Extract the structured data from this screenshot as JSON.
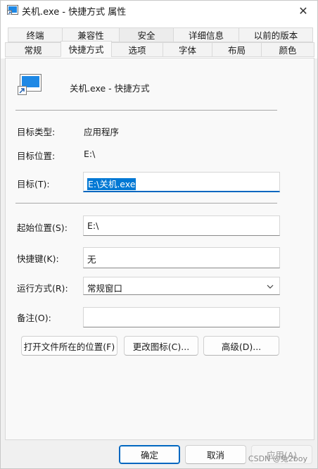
{
  "window": {
    "title": "关机.exe - 快捷方式 属性",
    "close_glyph": "✕"
  },
  "tabs": {
    "row1": [
      "终端",
      "兼容性",
      "安全",
      "详细信息",
      "以前的版本"
    ],
    "row2": [
      "常规",
      "快捷方式",
      "选项",
      "字体",
      "布局",
      "颜色"
    ],
    "active": "快捷方式"
  },
  "panel": {
    "shortcut_name": "关机.exe - 快捷方式",
    "target_type_label": "目标类型:",
    "target_type_value": "应用程序",
    "target_location_label": "目标位置:",
    "target_location_value": "E:\\",
    "target_label": "目标(T):",
    "target_value": "E:\\关机.exe",
    "start_in_label": "起始位置(S):",
    "start_in_value": "E:\\",
    "hotkey_label": "快捷键(K):",
    "hotkey_value": "无",
    "run_label": "运行方式(R):",
    "run_value": "常规窗口",
    "comment_label": "备注(O):",
    "comment_value": "",
    "open_location_button": "打开文件所在的位置(F)",
    "change_icon_button": "更改图标(C)...",
    "advanced_button": "高级(D)..."
  },
  "footer": {
    "ok": "确定",
    "cancel": "取消",
    "apply": "应用(A)"
  },
  "watermark": "CSDN @兔2boy",
  "colors": {
    "accent": "#0078d4",
    "focus_underline": "#0067c0",
    "panel_bg": "#f9f9f9",
    "window_bg": "#f0f0f0"
  },
  "icons": {
    "title": "shortcut-app-icon",
    "big": "shortcut-app-icon",
    "close": "close-icon",
    "dropdown": "chevron-down-icon"
  }
}
